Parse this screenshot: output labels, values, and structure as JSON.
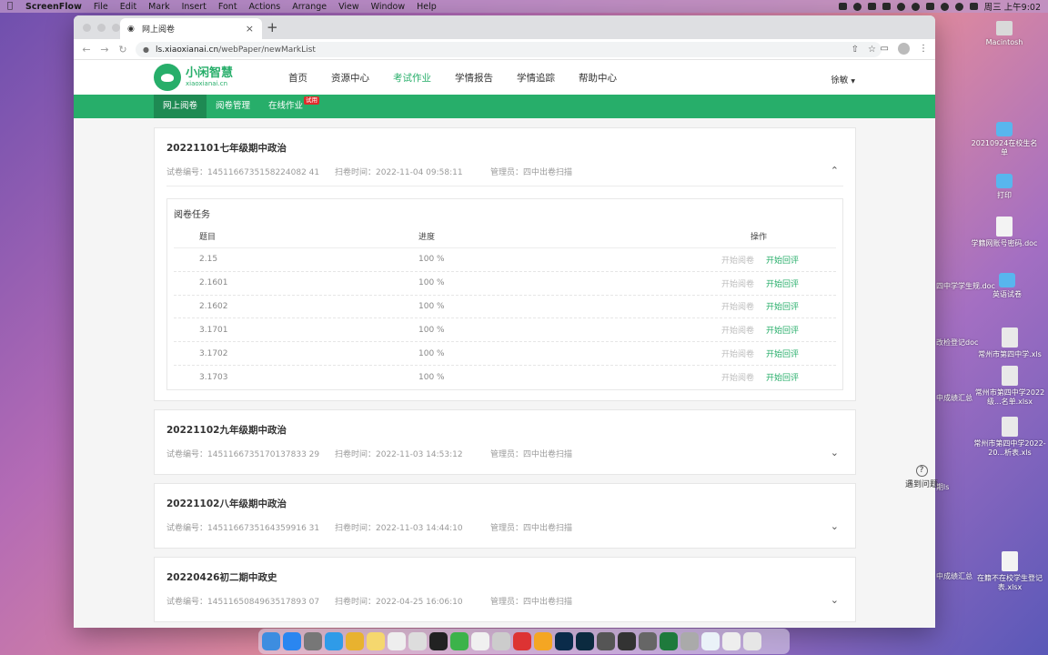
{
  "menubar": {
    "app": "ScreenFlow",
    "items": [
      "File",
      "Edit",
      "Mark",
      "Insert",
      "Font",
      "Actions",
      "Arrange",
      "View",
      "Window",
      "Help"
    ],
    "clock": "周三 上午9:02"
  },
  "desktop": {
    "icons": [
      {
        "label": "Macintosh",
        "type": "hd"
      },
      {
        "label": "20210924在校生名单",
        "type": "folder"
      },
      {
        "label": "打印",
        "type": "folder"
      },
      {
        "label": "学籍网账号密码.doc",
        "type": "doc"
      },
      {
        "label": "英语试卷",
        "type": "folder"
      },
      {
        "label": "常州市第四中学.xls",
        "type": "xls"
      },
      {
        "label": "常州市第四中学2022级...名单.xlsx",
        "type": "xls"
      },
      {
        "label": "常州市第四中学2022-20...析表.xls",
        "type": "xls"
      },
      {
        "label": "在籍不在校学生登记表.xlsx",
        "type": "doc"
      }
    ],
    "partials": [
      "四中学学生规.doc",
      "改检登记doc",
      "中成绩汇总",
      "期ls",
      "中成绩汇总"
    ]
  },
  "browser": {
    "tab_title": "网上阅卷",
    "url_domain": "ls.xiaoxianai.cn",
    "url_path": "/webPaper/newMarkList"
  },
  "header": {
    "logo_cn": "小闲智慧",
    "logo_en": "xiaoxianai.cn",
    "nav": [
      "首页",
      "资源中心",
      "考试作业",
      "学情报告",
      "学情追踪",
      "帮助中心"
    ],
    "active_nav": "考试作业",
    "user": "徐敏"
  },
  "subnav": {
    "items": [
      "网上阅卷",
      "阅卷管理",
      "在线作业"
    ],
    "badge": "试用"
  },
  "exams": [
    {
      "title": "20221101七年级期中政治",
      "code": "试卷编号：1451166735158224082 41",
      "scan": "扫卷时间：2022-11-04 09:58:11",
      "admin": "管理员：四中出卷扫描",
      "expanded": true
    },
    {
      "title": "20221102九年级期中政治",
      "code": "试卷编号：1451166735170137833 29",
      "scan": "扫卷时间：2022-11-03 14:53:12",
      "admin": "管理员：四中出卷扫描",
      "expanded": false
    },
    {
      "title": "20221102八年级期中政治",
      "code": "试卷编号：1451166735164359916 31",
      "scan": "扫卷时间：2022-11-03 14:44:10",
      "admin": "管理员：四中出卷扫描",
      "expanded": false
    },
    {
      "title": "20220426初二期中政史",
      "code": "试卷编号：1451165084963517893 07",
      "scan": "扫卷时间：2022-04-25 16:06:10",
      "admin": "管理员：四中出卷扫描",
      "expanded": false
    }
  ],
  "task": {
    "title": "阅卷任务",
    "headers": {
      "question": "题目",
      "progress": "进度",
      "ops": "操作"
    },
    "rows": [
      {
        "q": "2.15",
        "p": "100 %"
      },
      {
        "q": "2.1601",
        "p": "100 %"
      },
      {
        "q": "2.1602",
        "p": "100 %"
      },
      {
        "q": "3.1701",
        "p": "100 %"
      },
      {
        "q": "3.1702",
        "p": "100 %"
      },
      {
        "q": "3.1703",
        "p": "100 %"
      }
    ],
    "btn_start": "开始阅卷",
    "btn_review": "开始回评"
  },
  "help": {
    "label": "遇到问题"
  }
}
